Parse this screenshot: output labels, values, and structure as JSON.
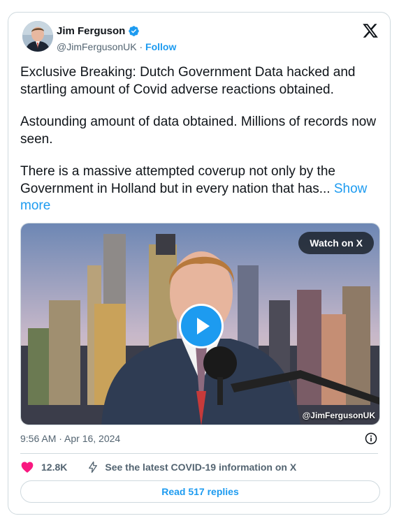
{
  "author": {
    "name": "Jim Ferguson",
    "handle": "@JimFergusonUK",
    "separator": "·",
    "follow_label": "Follow",
    "verified": true
  },
  "tweet": {
    "paragraphs": [
      "Exclusive Breaking: Dutch Government Data hacked and startling amount of Covid adverse reactions obtained.",
      "Astounding amount of data obtained. Millions of records now seen."
    ],
    "last_paragraph": "There is a massive attempted coverup not only by the Government in Holland but in every nation that has...",
    "show_more_label": "Show more"
  },
  "media": {
    "watch_label": "Watch on X",
    "watermark": "@JimFergusonUK"
  },
  "meta": {
    "timestamp": "9:56 AM · Apr 16, 2024"
  },
  "actions": {
    "like_count": "12.8K",
    "covid_info": "See the latest COVID-19 information on X"
  },
  "read_replies_label": "Read 517 replies",
  "colors": {
    "accent": "#1d9bf0",
    "like": "#f91880",
    "muted": "#536471"
  },
  "icons": [
    "verified-badge-icon",
    "x-logo-icon",
    "play-icon",
    "info-icon",
    "heart-icon",
    "lightning-icon"
  ]
}
